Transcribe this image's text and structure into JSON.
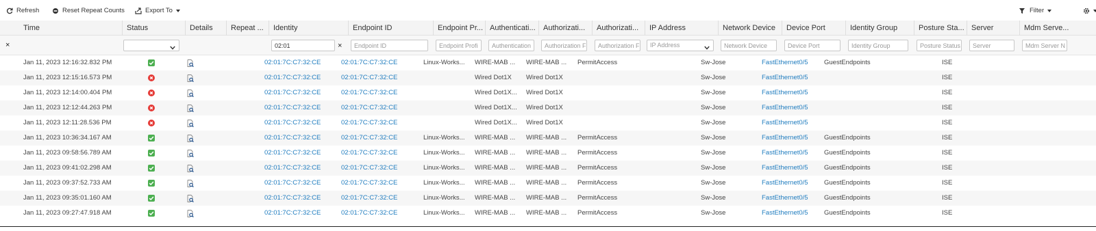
{
  "toolbar": {
    "refresh_label": "Refresh",
    "reset_label": "Reset Repeat Counts",
    "export_label": "Export To",
    "filter_label": "Filter"
  },
  "columns": [
    "Time",
    "Status",
    "Details",
    "Repeat ...",
    "Identity",
    "Endpoint ID",
    "Endpoint Pr...",
    "Authenticati...",
    "Authorizati...",
    "Authorizati...",
    "IP Address",
    "Network Device",
    "Device Port",
    "Identity Group",
    "Posture Sta...",
    "Server",
    "Mdm Serve..."
  ],
  "filters": {
    "identity_value": "02:01",
    "endpoint_id": "Endpoint ID",
    "endpoint_profile": "Endpoint Profi",
    "authentication": "Authentication",
    "authorization1": "Authorization F",
    "authorization2": "Authorization F",
    "ip_address": "IP Address",
    "network_device": "Network Device",
    "device_port": "Device Port",
    "identity_group": "Identity Group",
    "posture_status": "Posture Status",
    "server": "Server",
    "mdm_server": "Mdm Server N",
    "clear_all": "×",
    "clear_identity": "×"
  },
  "rows": [
    {
      "time": "Jan 11, 2023 12:16:32.832 PM",
      "status": "pass",
      "identity": "02:01:7C:C7:32:CE",
      "endpoint": "02:01:7C:C7:32:CE",
      "profile": "Linux-Works...",
      "authn": "WIRE-MAB ...",
      "authz": "WIRE-MAB ...",
      "authz2": "PermitAccess",
      "device": "Sw-Jose",
      "port": "FastEthernet0/5",
      "group": "GuestEndpoints",
      "server": "ISE"
    },
    {
      "time": "Jan 11, 2023 12:15:16.573 PM",
      "status": "fail",
      "identity": "02:01:7C:C7:32:CE",
      "endpoint": "02:01:7C:C7:32:CE",
      "profile": "",
      "authn": "Wired Dot1X",
      "authz": "Wired Dot1X",
      "authz2": "",
      "device": "Sw-Jose",
      "port": "FastEthernet0/5",
      "group": "",
      "server": "ISE"
    },
    {
      "time": "Jan 11, 2023 12:14:00.404 PM",
      "status": "fail",
      "identity": "02:01:7C:C7:32:CE",
      "endpoint": "02:01:7C:C7:32:CE",
      "profile": "",
      "authn": "Wired Dot1X...",
      "authz": "Wired Dot1X",
      "authz2": "",
      "device": "Sw-Jose",
      "port": "FastEthernet0/5",
      "group": "",
      "server": "ISE"
    },
    {
      "time": "Jan 11, 2023 12:12:44.263 PM",
      "status": "fail",
      "identity": "02:01:7C:C7:32:CE",
      "endpoint": "02:01:7C:C7:32:CE",
      "profile": "",
      "authn": "Wired Dot1X...",
      "authz": "Wired Dot1X",
      "authz2": "",
      "device": "Sw-Jose",
      "port": "FastEthernet0/5",
      "group": "",
      "server": "ISE"
    },
    {
      "time": "Jan 11, 2023 12:11:28.536 PM",
      "status": "fail",
      "identity": "02:01:7C:C7:32:CE",
      "endpoint": "02:01:7C:C7:32:CE",
      "profile": "",
      "authn": "Wired Dot1X...",
      "authz": "Wired Dot1X",
      "authz2": "",
      "device": "Sw-Jose",
      "port": "FastEthernet0/5",
      "group": "",
      "server": "ISE"
    },
    {
      "time": "Jan 11, 2023 10:36:34.167 AM",
      "status": "pass",
      "identity": "02:01:7C:C7:32:CE",
      "endpoint": "02:01:7C:C7:32:CE",
      "profile": "Linux-Works...",
      "authn": "WIRE-MAB ...",
      "authz": "WIRE-MAB ...",
      "authz2": "PermitAccess",
      "device": "Sw-Jose",
      "port": "FastEthernet0/5",
      "group": "GuestEndpoints",
      "server": "ISE"
    },
    {
      "time": "Jan 11, 2023 09:58:56.789 AM",
      "status": "pass",
      "identity": "02:01:7C:C7:32:CE",
      "endpoint": "02:01:7C:C7:32:CE",
      "profile": "Linux-Works...",
      "authn": "WIRE-MAB ...",
      "authz": "WIRE-MAB ...",
      "authz2": "PermitAccess",
      "device": "Sw-Jose",
      "port": "FastEthernet0/5",
      "group": "GuestEndpoints",
      "server": "ISE"
    },
    {
      "time": "Jan 11, 2023 09:41:02.298 AM",
      "status": "pass",
      "identity": "02:01:7C:C7:32:CE",
      "endpoint": "02:01:7C:C7:32:CE",
      "profile": "Linux-Works...",
      "authn": "WIRE-MAB ...",
      "authz": "WIRE-MAB ...",
      "authz2": "PermitAccess",
      "device": "Sw-Jose",
      "port": "FastEthernet0/5",
      "group": "GuestEndpoints",
      "server": "ISE"
    },
    {
      "time": "Jan 11, 2023 09:37:52.733 AM",
      "status": "pass",
      "identity": "02:01:7C:C7:32:CE",
      "endpoint": "02:01:7C:C7:32:CE",
      "profile": "Linux-Works...",
      "authn": "WIRE-MAB ...",
      "authz": "WIRE-MAB ...",
      "authz2": "PermitAccess",
      "device": "Sw-Jose",
      "port": "FastEthernet0/5",
      "group": "GuestEndpoints",
      "server": "ISE"
    },
    {
      "time": "Jan 11, 2023 09:35:01.160 AM",
      "status": "pass",
      "identity": "02:01:7C:C7:32:CE",
      "endpoint": "02:01:7C:C7:32:CE",
      "profile": "Linux-Works...",
      "authn": "WIRE-MAB ...",
      "authz": "WIRE-MAB ...",
      "authz2": "PermitAccess",
      "device": "Sw-Jose",
      "port": "FastEthernet0/5",
      "group": "GuestEndpoints",
      "server": "ISE"
    },
    {
      "time": "Jan 11, 2023 09:27:47.918 AM",
      "status": "pass",
      "identity": "02:01:7C:C7:32:CE",
      "endpoint": "02:01:7C:C7:32:CE",
      "profile": "Linux-Works...",
      "authn": "WIRE-MAB ...",
      "authz": "WIRE-MAB ...",
      "authz2": "PermitAccess",
      "device": "Sw-Jose",
      "port": "FastEthernet0/5",
      "group": "GuestEndpoints",
      "server": "ISE"
    }
  ],
  "colors": {
    "link": "#1f7cbf",
    "pass": "#4caf50",
    "fail": "#e53935"
  },
  "icons": {
    "status_pass": "check-square-icon",
    "status_fail": "x-circle-icon",
    "details": "magnifier-doc-icon"
  }
}
